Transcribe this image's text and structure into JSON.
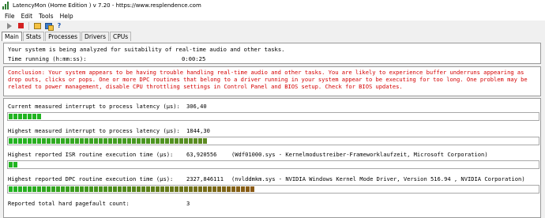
{
  "window": {
    "title": "LatencyMon  (Home Edition )  v 7.20 - https://www.resplendence.com"
  },
  "menu": {
    "items": [
      "File",
      "Edit",
      "Tools",
      "Help"
    ]
  },
  "toolbar": {
    "icons": [
      "play-icon",
      "stop-icon",
      "open-icon",
      "computer-icon",
      "help-icon"
    ]
  },
  "tabs": [
    "Main",
    "Stats",
    "Processes",
    "Drivers",
    "CPUs"
  ],
  "status": {
    "analysis_text": "Your system is being analyzed for suitability of real-time audio and other tasks.",
    "time_label": "Time running (h:mm:ss):",
    "time_value": "0:00:25"
  },
  "conclusion": {
    "text": "Conclusion: Your system appears to be having trouble handling real-time audio and other tasks. You are likely to experience buffer underruns appearing as drop outs, clicks or pops. One or more DPC routines that belong to a driver running in your system appear to be executing for too long. One problem may be related to power management, disable CPU throttling settings in Control Panel and BIOS setup. Check for BIOS updates.",
    "color": "#d40000"
  },
  "metrics": {
    "current_interrupt": {
      "label": "Current measured interrupt to process latency (µs):",
      "value": "306,40",
      "fill_segments": 7,
      "color": "#22b422"
    },
    "highest_interrupt": {
      "label": "Highest measured interrupt to process latency (µs):",
      "value": "1844,30",
      "fill_segments": 42,
      "gradient_end": "#5d8a22"
    },
    "highest_isr": {
      "label": "Highest reported ISR routine execution time (µs):",
      "value": "63,920556",
      "description": "Wdf01000.sys - Kernelmodustreiber-Frameworklaufzeit, Microsoft Corporation",
      "fill_segments": 2,
      "color": "#22b422"
    },
    "highest_dpc": {
      "label": "Highest reported DPC routine execution time (µs):",
      "value": "2327,846111",
      "description": "nvlddmkm.sys - NVIDIA Windows Kernel Mode Driver, Version 516.94 , NVIDIA Corporation",
      "fill_segments": 52,
      "gradient_end": "#8a5a16"
    },
    "hard_pagefault": {
      "label": "Reported total hard pagefault count:",
      "value": "3"
    }
  }
}
